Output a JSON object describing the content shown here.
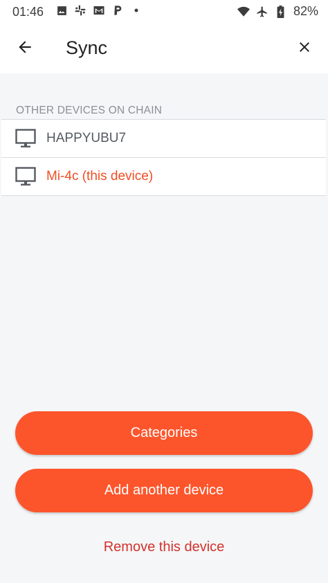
{
  "status_bar": {
    "time": "01:46",
    "battery": "82%",
    "icons_left": [
      "image-icon",
      "slack-icon",
      "gmail-icon",
      "paypal-icon",
      "dot-icon"
    ],
    "icons_right": [
      "wifi-icon",
      "airplane-icon",
      "battery-icon"
    ]
  },
  "app_bar": {
    "title": "Sync",
    "back_icon": "arrow-left-icon",
    "close_icon": "close-icon"
  },
  "devices_section": {
    "header": "OTHER DEVICES ON CHAIN",
    "items": [
      {
        "label": "HAPPYUBU7",
        "icon": "monitor-icon",
        "current": false
      },
      {
        "label": "Mi-4c (this device)",
        "icon": "monitor-icon",
        "current": true
      }
    ]
  },
  "actions": {
    "categories_label": "Categories",
    "add_device_label": "Add another device",
    "remove_device_label": "Remove this device"
  },
  "colors": {
    "accent": "#fd552b",
    "current_device_text": "#f04e23",
    "remove_link": "#d3322b",
    "background": "#f5f6f8"
  }
}
